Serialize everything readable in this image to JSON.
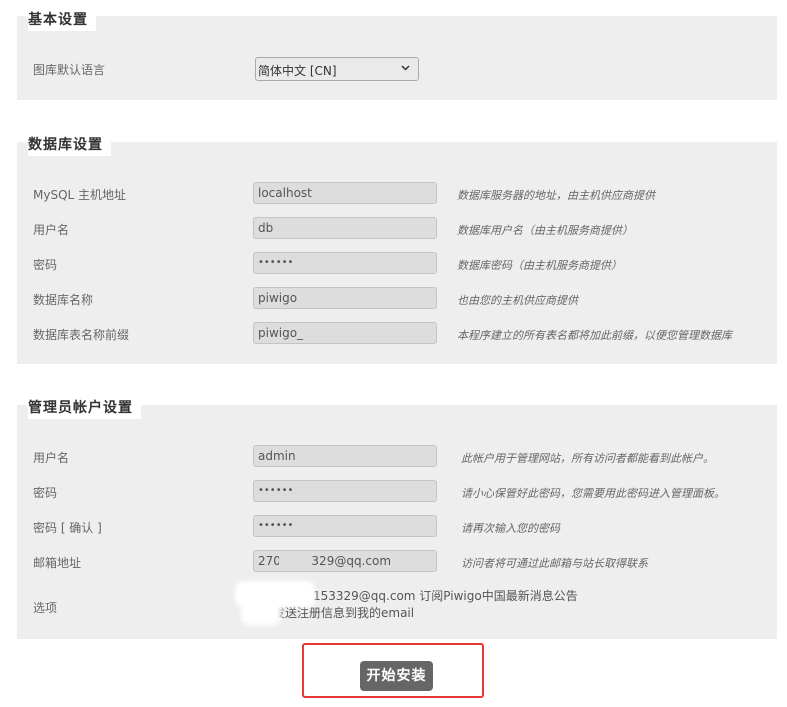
{
  "basic": {
    "title": "基本设置",
    "language_label": "图库默认语言",
    "language_value": "简体中文 [CN]"
  },
  "database": {
    "title": "数据库设置",
    "fields": [
      {
        "label": "MySQL 主机地址",
        "value": "localhost",
        "hint": "数据库服务器的地址，由主机供应商提供"
      },
      {
        "label": "用户名",
        "value": "db",
        "hint": "数据库用户名（由主机服务商提供）"
      },
      {
        "label": "密码",
        "value": "••••••",
        "hint": "数据库密码（由主机服务商提供）"
      },
      {
        "label": "数据库名称",
        "value": "piwigo",
        "hint": "也由您的主机供应商提供"
      },
      {
        "label": "数据库表名称前缀",
        "value": "piwigo_",
        "hint": "本程序建立的所有表名都将加此前缀，以便您管理数据库"
      }
    ]
  },
  "admin": {
    "title": "管理员帐户设置",
    "fields": [
      {
        "label": "用户名",
        "value": "admin",
        "hint": "此帐户用于管理网站，所有访问者都能看到此帐户。"
      },
      {
        "label": "密码",
        "value": "••••••",
        "hint": "请小心保管好此密码，您需要用此密码进入管理面板。"
      },
      {
        "label": "密码 [ 确认 ]",
        "value": "••••••",
        "hint": "请再次输入您的密码"
      },
      {
        "label": "邮箱地址",
        "value": "270        329@qq.com",
        "hint": "访问者将可通过此邮箱与站长取得联系"
      }
    ],
    "options_label": "选项",
    "option1": "153329@qq.com 订阅Piwigo中国最新消息公告",
    "option2": "发送注册信息到我的email"
  },
  "submit_label": "开始安装"
}
